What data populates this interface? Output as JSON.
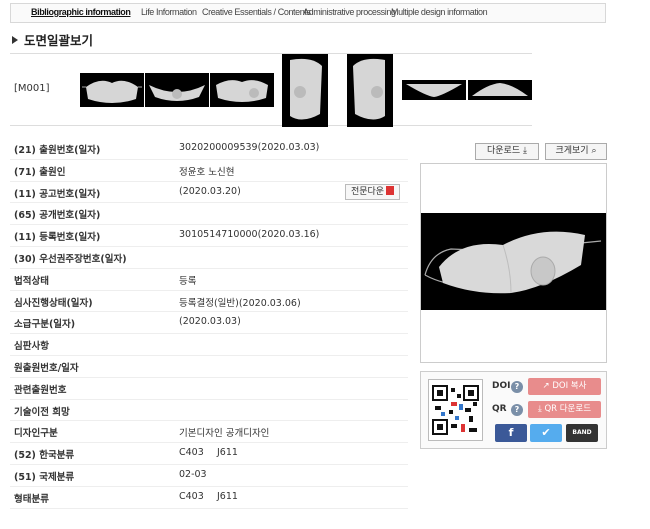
{
  "tabs": [
    {
      "label": "Bibliographic information",
      "active": true
    },
    {
      "label": "Life Information",
      "active": false
    },
    {
      "label": "Creative Essentials / Contents",
      "active": false
    },
    {
      "label": "Administrative processing",
      "active": false
    },
    {
      "label": "Multiple design information",
      "active": false
    }
  ],
  "section_title": "도면일괄보기",
  "drawings": {
    "code": "[M001]",
    "count": 7
  },
  "rows": [
    {
      "label": "(21) 출원번호(일자)",
      "value": "3020200009539(2020.03.03)"
    },
    {
      "label": "(71) 출원인",
      "value": "정윤호 노신현"
    },
    {
      "label": "(11) 공고번호(일자)",
      "value": "(2020.03.20)"
    },
    {
      "label": "(65) 공개번호(일자)",
      "value": ""
    },
    {
      "label": "(11) 등록번호(일자)",
      "value": "3010514710000(2020.03.16)"
    },
    {
      "label": "(30) 우선권주장번호(일자)",
      "value": ""
    },
    {
      "label": "법적상태",
      "value": "등록"
    },
    {
      "label": "심사진행상태(일자)",
      "value": "등록결정(일반)(2020.03.06)"
    },
    {
      "label": "소급구분(일자)",
      "value": "(2020.03.03)"
    },
    {
      "label": "심판사항",
      "value": ""
    },
    {
      "label": "원출원번호/일자",
      "value": ""
    },
    {
      "label": "관련출원번호",
      "value": ""
    },
    {
      "label": "기술이전 희망",
      "value": ""
    },
    {
      "label": "디자인구분",
      "value": "기본디자인 공개디자인"
    },
    {
      "label": "(52) 한국분류",
      "value": "C403",
      "value2": "J611"
    },
    {
      "label": "(51) 국제분류",
      "value": "02-03"
    },
    {
      "label": "형태분류",
      "value": "C403",
      "value2": "J611"
    }
  ],
  "fulltext_button": "전문다운",
  "download_button": "다운로드",
  "zoom_button": "크게보기",
  "share": {
    "doi_label": "DOI",
    "qr_label": "QR",
    "doi_copy": "DOI 복사",
    "qr_download": "QR 다운로드",
    "band_label": "BAND"
  }
}
